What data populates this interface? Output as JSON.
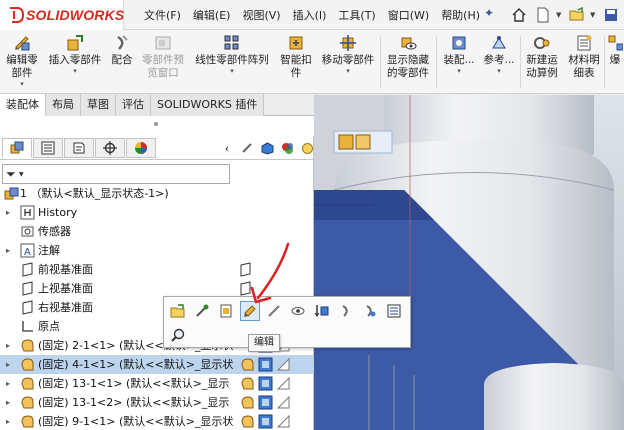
{
  "app": {
    "brand": "SOLIDWORKS"
  },
  "menu": [
    "文件(F)",
    "编辑(E)",
    "视图(V)",
    "插入(I)",
    "工具(T)",
    "窗口(W)",
    "帮助(H)"
  ],
  "ribbon": [
    {
      "label1": "编辑零",
      "label2": "部件",
      "caret": true,
      "icon": "edit-component-icon"
    },
    {
      "label1": "插入零部件",
      "label2": "",
      "caret": true,
      "icon": "insert-component-icon"
    },
    {
      "label1": "配合",
      "label2": "",
      "caret": false,
      "icon": "mate-icon"
    },
    {
      "label1": "零部件预",
      "label2": "览窗口",
      "caret": false,
      "disabled": true,
      "icon": "component-preview-icon"
    },
    {
      "label1": "线性零部件阵列",
      "label2": "",
      "caret": true,
      "icon": "linear-pattern-icon"
    },
    {
      "label1": "智能扣",
      "label2": "件",
      "caret": false,
      "icon": "smart-fasteners-icon"
    },
    {
      "label1": "移动零部件",
      "label2": "",
      "caret": true,
      "icon": "move-component-icon"
    },
    {
      "label1": "显示隐藏",
      "label2": "的零部件",
      "caret": false,
      "icon": "show-hidden-icon"
    },
    {
      "label1": "装配...",
      "label2": "",
      "caret": true,
      "icon": "assembly-features-icon"
    },
    {
      "label1": "参考...",
      "label2": "",
      "caret": true,
      "icon": "reference-geometry-icon"
    },
    {
      "label1": "新建运",
      "label2": "动算例",
      "caret": false,
      "icon": "new-motion-study-icon"
    },
    {
      "label1": "材料明",
      "label2": "细表",
      "caret": false,
      "icon": "bom-icon"
    },
    {
      "label1": "爆",
      "label2": "",
      "caret": false,
      "icon": "exploded-view-icon"
    }
  ],
  "tabs": [
    "装配体",
    "布局",
    "草图",
    "评估",
    "SOLIDWORKS 插件"
  ],
  "tree": {
    "root": "1 （默认<默认_显示状态-1>)",
    "items": [
      "History",
      "传感器",
      "注解",
      "前视基准面",
      "上视基准面",
      "右视基准面",
      "原点",
      "(固定) 2-1<1> (默认<<默认>_显示状",
      "(固定) 4-1<1> (默认<<默认>_显示状",
      "(固定) 13-1<1> (默认<<默认>_显示",
      "(固定) 13-1<2> (默认<<默认>_显示",
      "(固定) 9-1<1> (默认<<默认>_显示状"
    ]
  },
  "tooltip": "编辑",
  "colors": {
    "accent": "#d52b1e",
    "selection": "#bcd4ee",
    "part_blue": "#3d5aa6"
  }
}
